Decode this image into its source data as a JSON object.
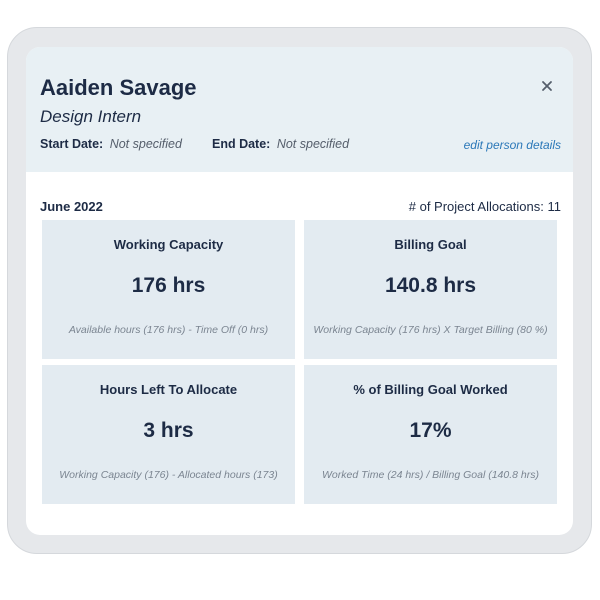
{
  "person": {
    "name": "Aaiden Savage",
    "role": "Design Intern"
  },
  "dates": {
    "start_label": "Start Date:",
    "start_value": "Not specified",
    "end_label": "End Date:",
    "end_value": "Not specified"
  },
  "edit_link": "edit person details",
  "close_icon": "close-icon",
  "summary": {
    "month": "June 2022",
    "allocations": "# of Project Allocations: 11"
  },
  "cards": [
    {
      "title": "Working Capacity",
      "value": "176 hrs",
      "note": "Available hours (176 hrs) - Time Off (0 hrs)"
    },
    {
      "title": "Billing Goal",
      "value": "140.8 hrs",
      "note": "Working Capacity (176 hrs) X Target Billing (80 %)"
    },
    {
      "title": "Hours Left To Allocate",
      "value": "3 hrs",
      "note": "Working Capacity (176) - Allocated hours (173)"
    },
    {
      "title": "% of Billing Goal Worked",
      "value": "17%",
      "note": "Worked Time (24 hrs) / Billing Goal (140.8 hrs)"
    }
  ],
  "colors": {
    "header_bg": "#e8f0f4",
    "card_bg": "#e3ebf1",
    "text": "#1d2b45",
    "link": "#2b78b8",
    "muted": "#7b8591"
  }
}
